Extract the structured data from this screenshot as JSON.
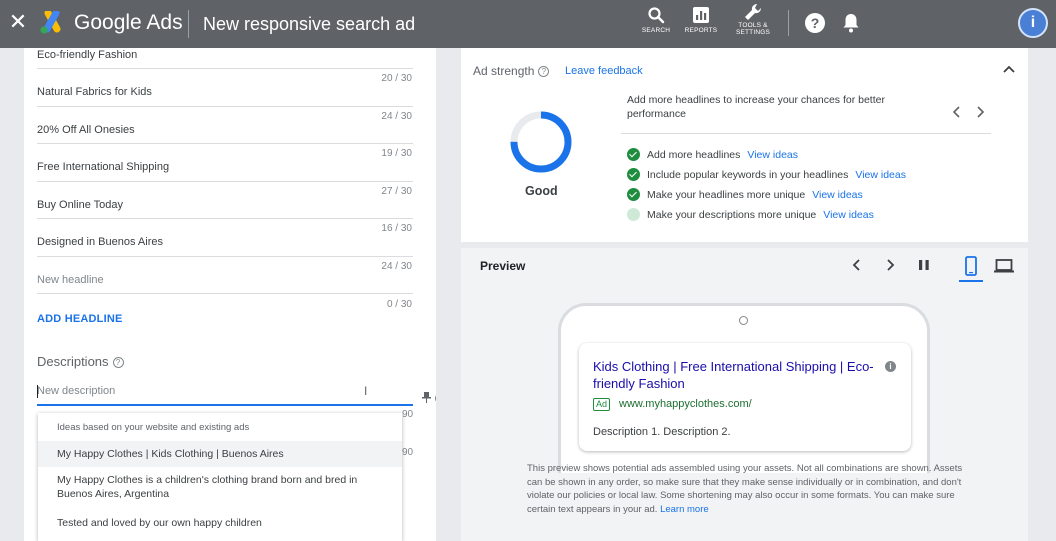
{
  "topbar": {
    "close": "✕",
    "brand": "Google Ads",
    "title": "New responsive search ad",
    "tools": [
      {
        "label": "SEARCH"
      },
      {
        "label": "REPORTS"
      },
      {
        "label": "TOOLS &\nSETTINGS"
      }
    ],
    "help": "?",
    "avatar": "i"
  },
  "headlines": {
    "rows": [
      {
        "text": "Eco-friendly Fashion",
        "count": "20 / 30"
      },
      {
        "text": "Natural Fabrics for Kids",
        "count": "24 / 30"
      },
      {
        "text": "20% Off All Onesies",
        "count": "19 / 30"
      },
      {
        "text": "Free International Shipping",
        "count": "27 / 30"
      },
      {
        "text": "Buy Online Today",
        "count": "16 / 30"
      },
      {
        "text": "Designed in Buenos Aires",
        "count": "24 / 30"
      },
      {
        "text": "New headline",
        "count": "0 / 30"
      }
    ],
    "add_label": "ADD HEADLINE"
  },
  "descriptions": {
    "label": "Descriptions",
    "help": "?",
    "input_placeholder": "New description",
    "ibeam": "I",
    "pin": "📌?",
    "count_a": "90",
    "count_b": "90",
    "suggestions": {
      "header": "Ideas based on your website and existing ads",
      "items": [
        "My Happy Clothes | Kids Clothing | Buenos Aires",
        "My Happy Clothes is a children's clothing brand born and bred in Buenos Aires, Argentina",
        "Tested and loved by our own happy children"
      ]
    }
  },
  "ad_strength": {
    "title": "Ad strength",
    "help": "?",
    "feedback": "Leave feedback",
    "rating": "Good",
    "progress": 0.75,
    "message": "Add more headlines to increase your chances for better performance",
    "tips": [
      {
        "text": "Add more headlines",
        "link": "View ideas",
        "done": true
      },
      {
        "text": "Include popular keywords in your headlines",
        "link": "View ideas",
        "done": true
      },
      {
        "text": "Make your headlines more unique",
        "link": "View ideas",
        "done": true
      },
      {
        "text": "Make your descriptions more unique",
        "link": "View ideas",
        "done": false
      }
    ],
    "colors": {
      "accent": "#1a73e8",
      "done": "#1e8e3e",
      "pending": "#ceead6"
    }
  },
  "preview": {
    "title": "Preview",
    "ad": {
      "headline": "Kids Clothing | Free International Shipping | Eco-friendly Fashion",
      "badge": "Ad",
      "url": "www.myhappyclothes.com/",
      "description": "Description 1. Description 2.",
      "info": "i"
    },
    "disclaimer": "This preview shows potential ads assembled using your assets. Not all combinations are shown. Assets can be shown in any order, so make sure that they make sense individually or in combination, and don't violate our policies or local law. Some shortening may also occur in some formats. You can make sure certain text appears in your ad.",
    "learn_more": "Learn more"
  }
}
